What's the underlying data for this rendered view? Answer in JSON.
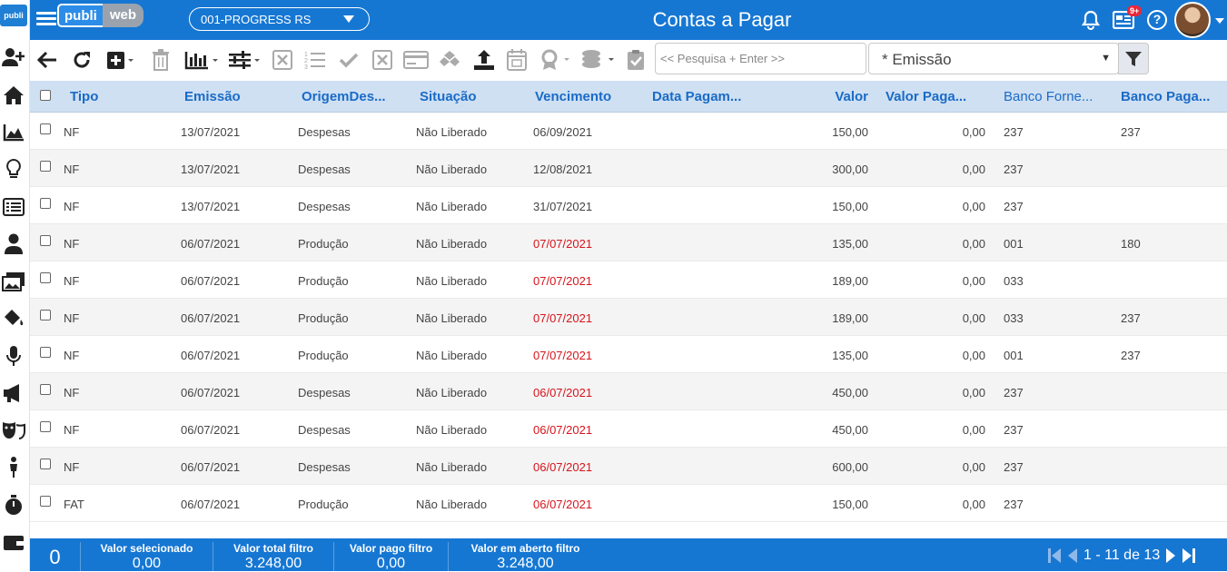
{
  "app": {
    "logo_small": "publi",
    "brand_left": "publi",
    "brand_right": "web",
    "company": "001-PROGRESS RS",
    "page_title": "Contas a Pagar",
    "notification_badge": "9+"
  },
  "toolbar": {
    "search_placeholder": "<< Pesquisa + Enter >>",
    "order_value": "* Emissão"
  },
  "table": {
    "headers": {
      "tipo": "Tipo",
      "emissao": "Emissão",
      "origem": "OrigemDes...",
      "situacao": "Situação",
      "vencimento": "Vencimento",
      "data_pagamento": "Data Pagam...",
      "valor": "Valor",
      "valor_pago": "Valor Paga...",
      "banco_fornecedor": "Banco Forne...",
      "banco_pagamento": "Banco Paga..."
    },
    "rows": [
      {
        "tipo": "NF",
        "emissao": "13/07/2021",
        "origem": "Despesas",
        "situacao": "Não Liberado",
        "vencimento": "06/09/2021",
        "overdue": false,
        "valor": "150,00",
        "valor_pago": "0,00",
        "banco_fornecedor": "237",
        "banco_pagamento": "237"
      },
      {
        "tipo": "NF",
        "emissao": "13/07/2021",
        "origem": "Despesas",
        "situacao": "Não Liberado",
        "vencimento": "12/08/2021",
        "overdue": false,
        "valor": "300,00",
        "valor_pago": "0,00",
        "banco_fornecedor": "237",
        "banco_pagamento": ""
      },
      {
        "tipo": "NF",
        "emissao": "13/07/2021",
        "origem": "Despesas",
        "situacao": "Não Liberado",
        "vencimento": "31/07/2021",
        "overdue": false,
        "valor": "150,00",
        "valor_pago": "0,00",
        "banco_fornecedor": "237",
        "banco_pagamento": ""
      },
      {
        "tipo": "NF",
        "emissao": "06/07/2021",
        "origem": "Produção",
        "situacao": "Não Liberado",
        "vencimento": "07/07/2021",
        "overdue": true,
        "valor": "135,00",
        "valor_pago": "0,00",
        "banco_fornecedor": "001",
        "banco_pagamento": "180"
      },
      {
        "tipo": "NF",
        "emissao": "06/07/2021",
        "origem": "Produção",
        "situacao": "Não Liberado",
        "vencimento": "07/07/2021",
        "overdue": true,
        "valor": "189,00",
        "valor_pago": "0,00",
        "banco_fornecedor": "033",
        "banco_pagamento": ""
      },
      {
        "tipo": "NF",
        "emissao": "06/07/2021",
        "origem": "Produção",
        "situacao": "Não Liberado",
        "vencimento": "07/07/2021",
        "overdue": true,
        "valor": "189,00",
        "valor_pago": "0,00",
        "banco_fornecedor": "033",
        "banco_pagamento": "237"
      },
      {
        "tipo": "NF",
        "emissao": "06/07/2021",
        "origem": "Produção",
        "situacao": "Não Liberado",
        "vencimento": "07/07/2021",
        "overdue": true,
        "valor": "135,00",
        "valor_pago": "0,00",
        "banco_fornecedor": "001",
        "banco_pagamento": "237"
      },
      {
        "tipo": "NF",
        "emissao": "06/07/2021",
        "origem": "Despesas",
        "situacao": "Não Liberado",
        "vencimento": "06/07/2021",
        "overdue": true,
        "valor": "450,00",
        "valor_pago": "0,00",
        "banco_fornecedor": "237",
        "banco_pagamento": ""
      },
      {
        "tipo": "NF",
        "emissao": "06/07/2021",
        "origem": "Despesas",
        "situacao": "Não Liberado",
        "vencimento": "06/07/2021",
        "overdue": true,
        "valor": "450,00",
        "valor_pago": "0,00",
        "banco_fornecedor": "237",
        "banco_pagamento": ""
      },
      {
        "tipo": "NF",
        "emissao": "06/07/2021",
        "origem": "Despesas",
        "situacao": "Não Liberado",
        "vencimento": "06/07/2021",
        "overdue": true,
        "valor": "600,00",
        "valor_pago": "0,00",
        "banco_fornecedor": "237",
        "banco_pagamento": ""
      },
      {
        "tipo": "FAT",
        "emissao": "06/07/2021",
        "origem": "Produção",
        "situacao": "Não Liberado",
        "vencimento": "06/07/2021",
        "overdue": true,
        "valor": "150,00",
        "valor_pago": "0,00",
        "banco_fornecedor": "237",
        "banco_pagamento": ""
      }
    ]
  },
  "footer": {
    "selected_count": "0",
    "valor_selecionado_label": "Valor selecionado",
    "valor_selecionado": "0,00",
    "valor_total_label": "Valor total filtro",
    "valor_total": "3.248,00",
    "valor_pago_label": "Valor pago filtro",
    "valor_pago": "0,00",
    "valor_aberto_label": "Valor em aberto filtro",
    "valor_aberto": "3.248,00",
    "pagination": "1 - 11 de 13"
  },
  "colors": {
    "primary": "#1677d3",
    "header_row": "#cfe0f3",
    "overdue": "#d7141c"
  }
}
